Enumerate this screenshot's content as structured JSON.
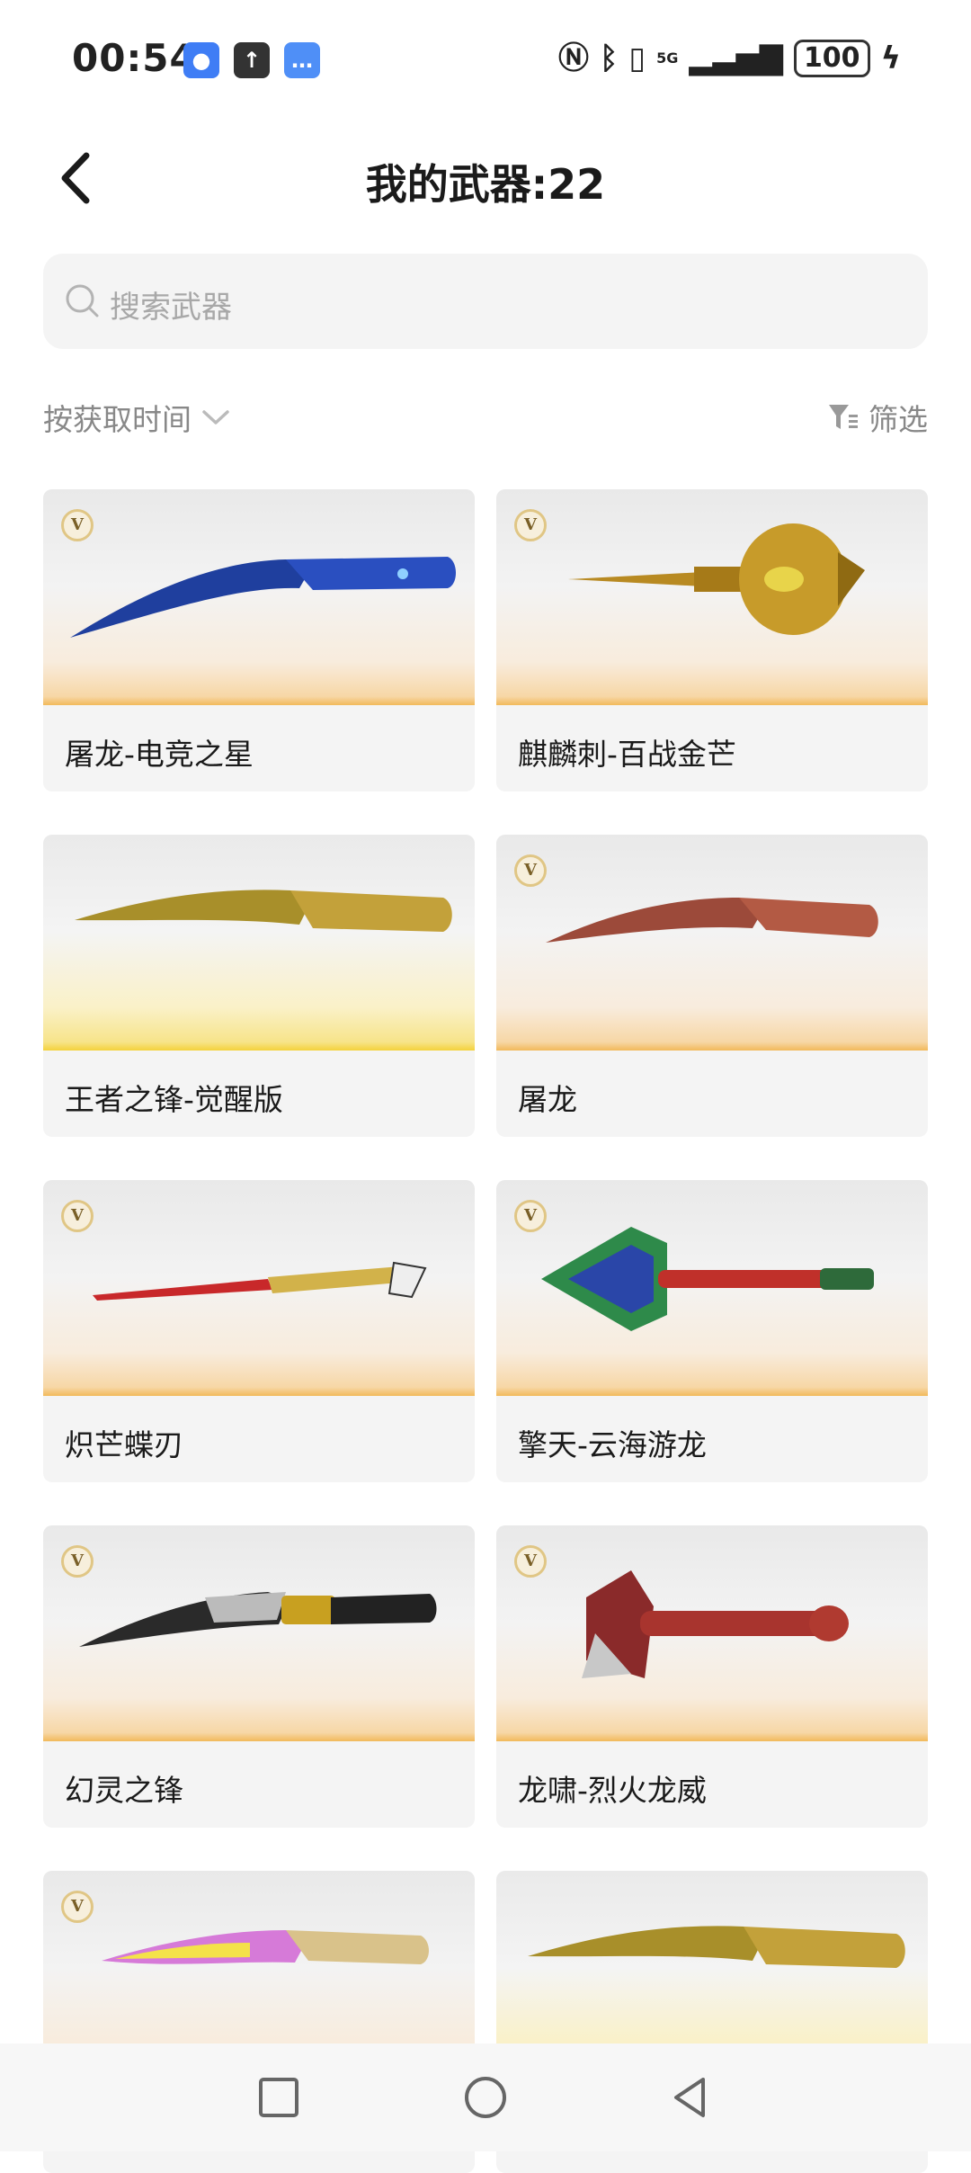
{
  "status_bar": {
    "time": "00:54",
    "battery": "100",
    "network": "5G",
    "icons": [
      "nfc-icon",
      "bluetooth-icon",
      "vibrate-icon",
      "signal-icon",
      "charging-icon"
    ]
  },
  "header": {
    "title": "我的武器:22"
  },
  "search": {
    "placeholder": "搜索武器"
  },
  "sort": {
    "label": "按获取时间"
  },
  "filter": {
    "label": "筛选"
  },
  "weapons": [
    {
      "name": "屠龙-电竞之星",
      "badge": "V"
    },
    {
      "name": "麒麟刺-百战金芒",
      "badge": "V"
    },
    {
      "name": "王者之锋-觉醒版",
      "badge": ""
    },
    {
      "name": "屠龙",
      "badge": "V"
    },
    {
      "name": "炽芒蝶刃",
      "badge": "V"
    },
    {
      "name": "擎天-云海游龙",
      "badge": "V"
    },
    {
      "name": "幻灵之锋",
      "badge": "V"
    },
    {
      "name": "龙啸-烈火龙威",
      "badge": "V"
    },
    {
      "name": "",
      "badge": "V"
    },
    {
      "name": "",
      "badge": ""
    }
  ],
  "colors": {
    "accent_orange": "#f2b95a",
    "accent_gold": "#f4d23c",
    "badge_gold": "#e0c685"
  }
}
